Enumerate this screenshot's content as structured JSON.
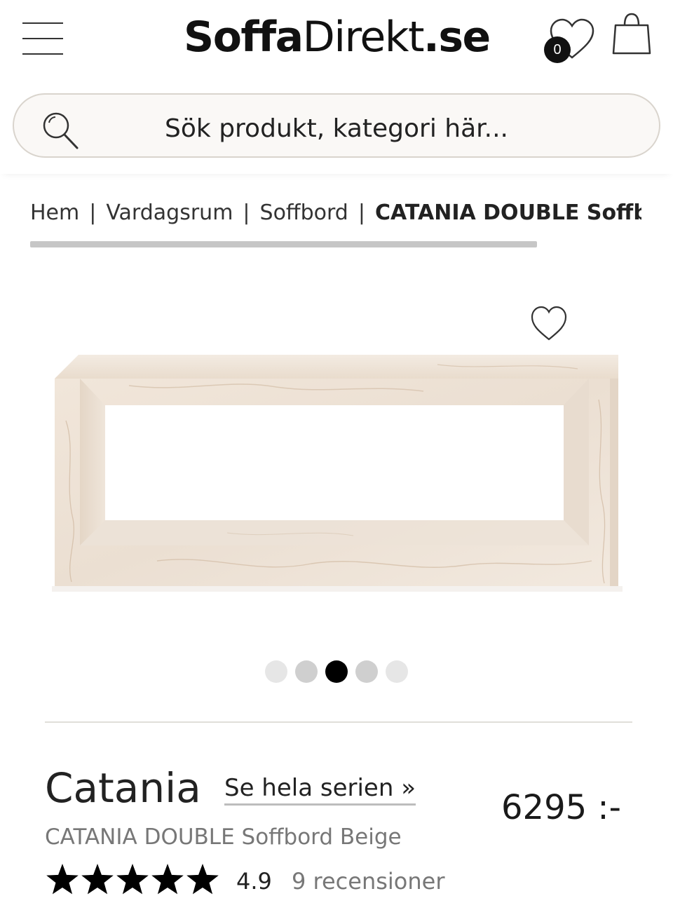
{
  "header": {
    "menu_icon": "hamburger-menu-icon",
    "logo_bold": "Soffa",
    "logo_regular": "Direkt",
    "logo_suffix": ".se",
    "wishlist_icon": "heart-icon",
    "wishlist_count": "0",
    "cart_icon": "shopping-bag-icon"
  },
  "search": {
    "icon": "search-icon",
    "placeholder": "Sök produkt, kategori här..."
  },
  "breadcrumb": {
    "items": [
      "Hem",
      "Vardagsrum",
      "Soffbord",
      "CATANIA DOUBLE Soffbord Beige"
    ],
    "separator": "|"
  },
  "gallery": {
    "favorite_icon": "heart-outline-icon",
    "image_count": 5,
    "active_index": 2
  },
  "product": {
    "series_name": "Catania",
    "series_link": "Se hela serien »",
    "price": "6295 :-",
    "full_name": "CATANIA DOUBLE Soffbord Beige",
    "rating_stars": 5,
    "rating_value": "4.9",
    "reviews_text": "9 recensioner"
  },
  "colors": {
    "text": "#1a1a1a",
    "muted": "#777777",
    "search_border": "#d9d4cd",
    "marble": "#efe3d6",
    "dot_active": "#000000"
  }
}
